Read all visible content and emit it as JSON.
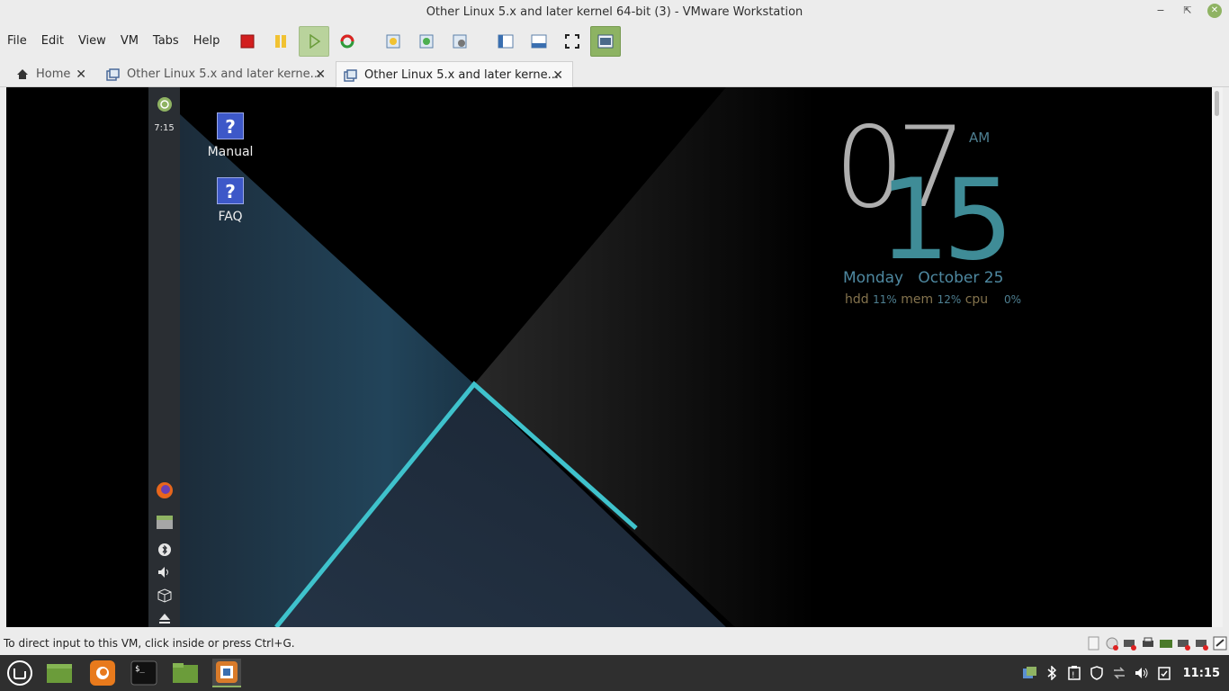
{
  "window": {
    "title": "Other Linux 5.x and later kernel 64-bit (3) - VMware Workstation"
  },
  "menu": {
    "file": "File",
    "edit": "Edit",
    "view": "View",
    "vm": "VM",
    "tabs": "Tabs",
    "help": "Help"
  },
  "tabs": [
    {
      "label": "Home"
    },
    {
      "label": "Other Linux 5.x and later kerne..."
    },
    {
      "label": "Other Linux 5.x and later kerne..."
    }
  ],
  "guest": {
    "panel_time": "7:15",
    "desktop_icons": [
      {
        "label": "Manual"
      },
      {
        "label": "FAQ"
      }
    ],
    "clock": {
      "hour": "07",
      "minute": "15",
      "ampm": "AM",
      "weekday": "Monday",
      "date": "October 25",
      "hdd_label": "hdd",
      "hdd_pct": "11%",
      "mem_label": "mem",
      "mem_pct": "12%",
      "cpu_label": "cpu",
      "cpu_pct": "0%"
    }
  },
  "statusbar": {
    "message": "To direct input to this VM, click inside or press Ctrl+G."
  },
  "taskbar": {
    "time": "11:15"
  },
  "colors": {
    "accent": "#8fb363",
    "vm_bg": "#000000",
    "taskbar": "#2f2f2f"
  }
}
